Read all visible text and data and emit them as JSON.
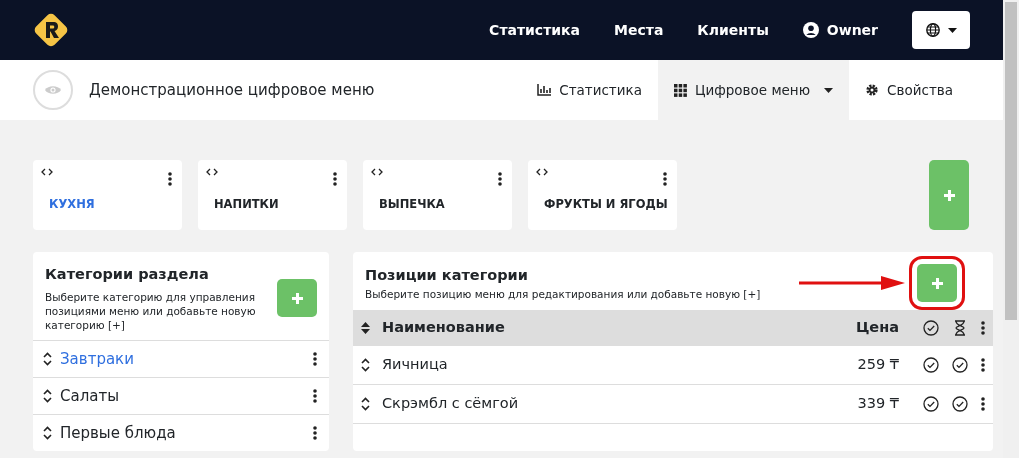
{
  "navbar": {
    "links": [
      "Статистика",
      "Места",
      "Клиенты"
    ],
    "user": "Owner"
  },
  "subnav": {
    "title": "Демонстрационное цифровое меню",
    "tabs": [
      {
        "label": "Статистика",
        "kind": "chart",
        "selected": false,
        "dropdown": false
      },
      {
        "label": "Цифровое меню",
        "kind": "grid",
        "selected": true,
        "dropdown": true
      },
      {
        "label": "Свойства",
        "kind": "gear",
        "selected": false,
        "dropdown": false
      }
    ]
  },
  "sections": [
    {
      "label": "КУХНЯ",
      "selected": true
    },
    {
      "label": "НАПИТКИ",
      "selected": false
    },
    {
      "label": "ВЫПЕЧКА",
      "selected": false
    },
    {
      "label": "ФРУКТЫ И ЯГОДЫ",
      "selected": false
    }
  ],
  "categories": {
    "title": "Категории раздела",
    "hint": "Выберите категорию для управления позициями меню или добавьте новую категорию [+]",
    "items": [
      {
        "label": "Завтраки",
        "selected": true
      },
      {
        "label": "Салаты",
        "selected": false
      },
      {
        "label": "Первые блюда",
        "selected": false
      }
    ]
  },
  "items": {
    "title": "Позиции категории",
    "hint": "Выберите позицию меню для редактирования или добавьте новую [+]",
    "columns": [
      "Наименование",
      "Цена"
    ],
    "rows": [
      {
        "name": "Яичница",
        "price": "259 ₸",
        "marks": [
          true,
          true
        ]
      },
      {
        "name": "Скрэмбл с сёмгой",
        "price": "339 ₸",
        "marks": [
          true,
          true
        ]
      }
    ]
  }
}
